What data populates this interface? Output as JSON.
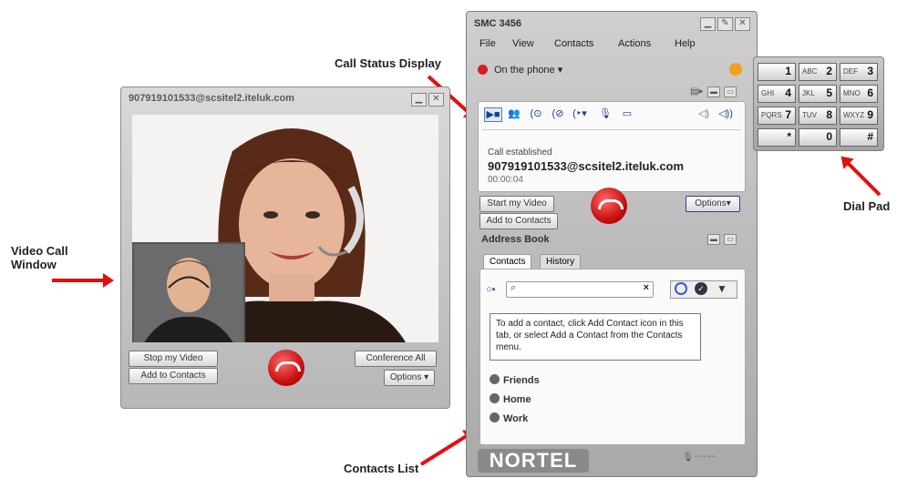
{
  "callouts": {
    "call_status": "Call Status Display",
    "video_window": "Video Call\nWindow",
    "dial_pad": "Dial Pad",
    "contacts_list": "Contacts List"
  },
  "video_window": {
    "title": "907919101533@scsitel2.iteluk.com",
    "buttons": {
      "stop_video": "Stop my Video",
      "add_contacts": "Add to Contacts",
      "conference_all": "Conference All",
      "options": "Options"
    }
  },
  "smc": {
    "title": "SMC 3456",
    "menu": [
      "File",
      "View",
      "Contacts",
      "Actions",
      "Help"
    ],
    "status": "On the phone",
    "call": {
      "state": "Call established",
      "address": "907919101533@scsitel2.iteluk.com",
      "duration": "00:00:04"
    },
    "buttons": {
      "start_video": "Start my Video",
      "add_contacts": "Add to Contacts",
      "options": "Options"
    },
    "address_book": {
      "title": "Address Book",
      "tabs": [
        "Contacts",
        "History"
      ],
      "help_text": "To add a contact, click Add Contact icon in this tab, or select Add a Contact from the Contacts menu.",
      "groups": [
        "Friends",
        "Home",
        "Work"
      ]
    },
    "brand": "NORTEL",
    "footer_status": "-----"
  },
  "dial_pad": {
    "keys": [
      {
        "sub": "",
        "num": "1"
      },
      {
        "sub": "ABC",
        "num": "2"
      },
      {
        "sub": "DEF",
        "num": "3"
      },
      {
        "sub": "GHI",
        "num": "4"
      },
      {
        "sub": "JKL",
        "num": "5"
      },
      {
        "sub": "MNO",
        "num": "6"
      },
      {
        "sub": "PQRS",
        "num": "7"
      },
      {
        "sub": "TUV",
        "num": "8"
      },
      {
        "sub": "WXYZ",
        "num": "9"
      },
      {
        "sub": "",
        "num": "*"
      },
      {
        "sub": "",
        "num": "0"
      },
      {
        "sub": "",
        "num": "#"
      }
    ]
  },
  "colors": {
    "accent_red": "#e01010",
    "hangup_red": "#c81010",
    "link_blue": "#1a3e8a"
  }
}
